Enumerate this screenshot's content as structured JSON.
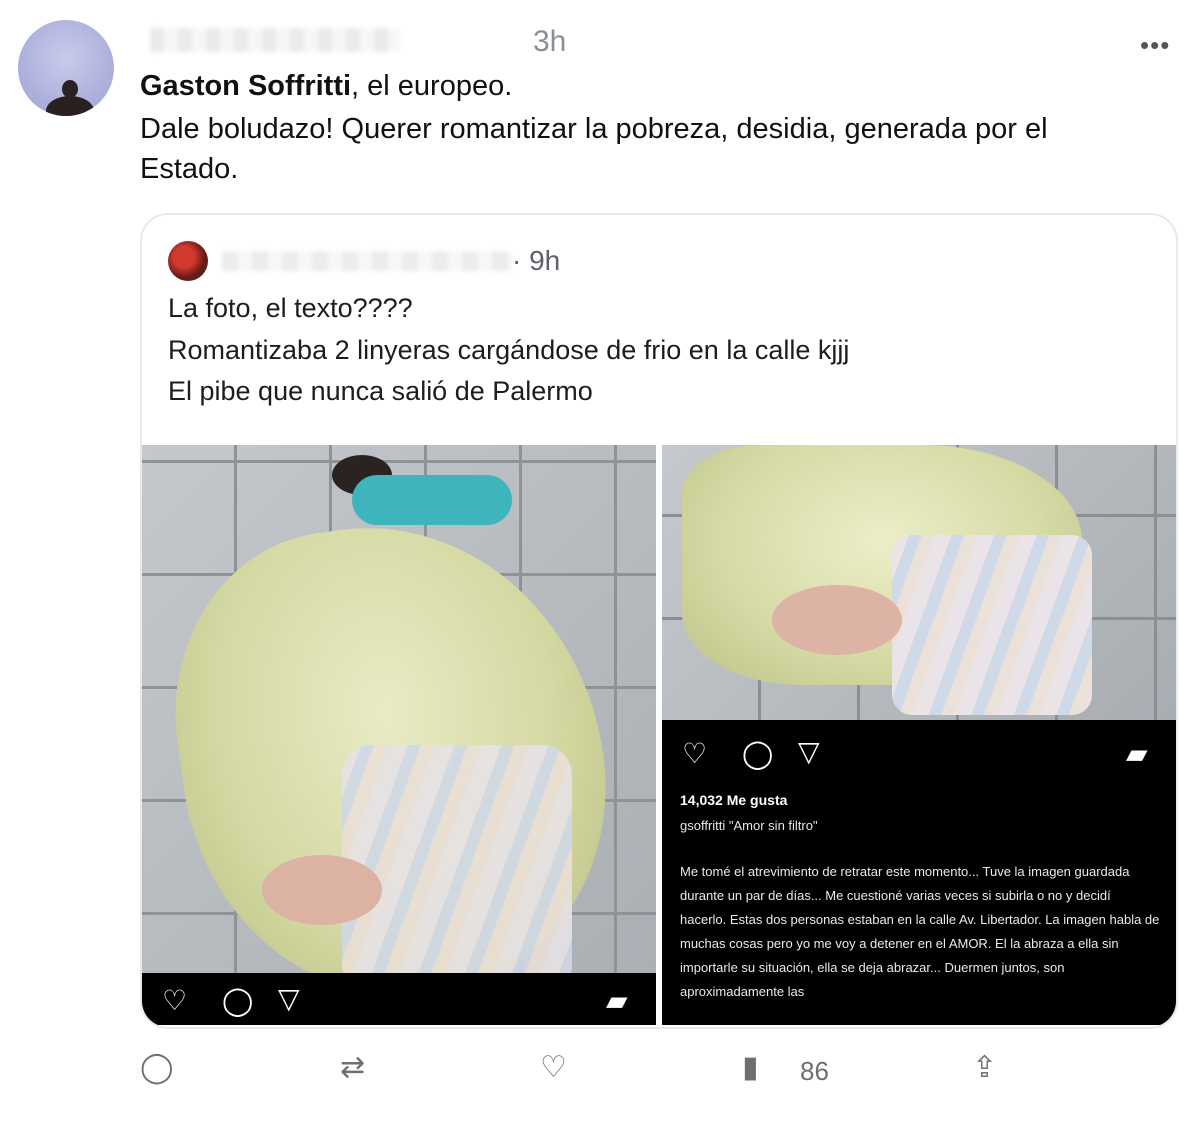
{
  "tweet": {
    "time": "3h",
    "author_name": "Gaston Soffritti",
    "author_suffix": ", el europeo.",
    "text_line1": "Dale boludazo! Querer romantizar la pobreza, desidia, generada por el",
    "text_line2": "Estado."
  },
  "quote": {
    "time": "· 9h",
    "line1": "La foto, el texto????",
    "line2": "Romantizaba 2 linyeras cargándose de frio en la calle kjjj",
    "line3": "El pibe que nunca salió de Palermo"
  },
  "instagram": {
    "likes": "14,032 Me gusta",
    "handle_line": "gsoffritti \"Amor sin filtro\"",
    "caption": "Me tomé el atrevimiento de retratar este momento... Tuve la imagen guardada durante un par de días... Me cuestioné varias veces si subirla o no y decidí hacerlo. Estas dos personas estaban en la calle Av. Libertador. La imagen habla de muchas cosas pero yo me voy a detener en el AMOR. El la abraza a ella sin importarle su situación, ella se deja abrazar... Duermen juntos, son aproximadamente las"
  },
  "actions": {
    "views": "86"
  },
  "icons": {
    "more": "more-horizontal-icon",
    "reply": "reply-icon",
    "retweet": "retweet-icon",
    "like": "like-icon",
    "views": "views-icon",
    "share": "share-icon",
    "ig_like": "heart-icon",
    "ig_comment": "comment-icon",
    "ig_send": "send-icon",
    "ig_save": "bookmark-icon"
  }
}
